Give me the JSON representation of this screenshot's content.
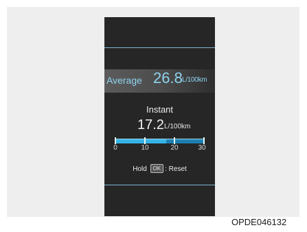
{
  "display": {
    "average": {
      "label": "Average",
      "value": "26.8",
      "unit": "L/100km"
    },
    "instant": {
      "label": "Instant",
      "value": "17.2",
      "unit": "L/100km",
      "gauge_min": 0,
      "gauge_max": 30,
      "gauge_value": 17.2,
      "ticks": [
        "0",
        "10",
        "20",
        "30"
      ]
    },
    "reset": {
      "prefix": "Hold",
      "key": "OK",
      "suffix": ": Reset"
    }
  },
  "caption": "OPDE046132",
  "colors": {
    "accent": "#8ed3ef",
    "gauge": "#35b3e6",
    "panel": "#262626"
  }
}
